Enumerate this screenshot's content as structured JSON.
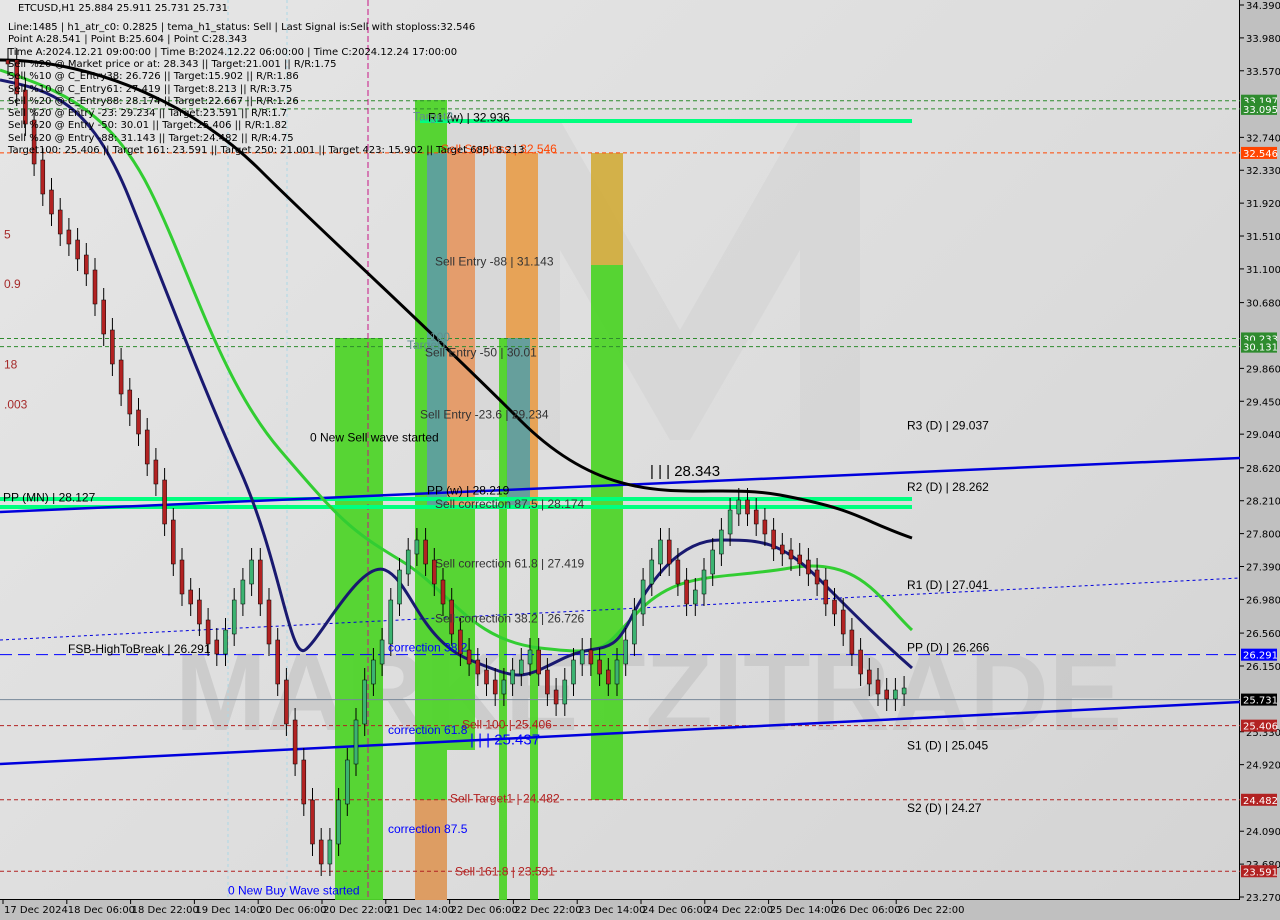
{
  "header": {
    "symbol_line": "ETCUSD,H1  25.884 25.911 25.731 25.731",
    "info_lines": [
      "Line:1485 | h1_atr_c0: 0.2825 | tema_h1_status: Sell | Last Signal is:Sell with stoploss:32.546",
      "Point A:28.541 | Point B:25.604 | Point C:28.343",
      "Time A:2024.12.21 09:00:00 | Time B:2024.12.22 06:00:00 | Time C:2024.12.24 17:00:00",
      "Sell %20 @ Market price or at: 28.343 || Target:21.001 || R/R:1.75",
      "Sell %10 @ C_Entry38: 26.726 || Target:15.902 || R/R:1.86",
      "Sell %10 @ C_Entry61: 27.419 || Target:8.213 || R/R:3.75",
      "Sell %20 @ C_Entry88: 28.174 || Target:22.667 || R/R:1.26",
      "Sell %20 @ Entry -23: 29.234 || Target:23.591 || R/R:1.7",
      "Sell %20 @ Entry -50: 30.01 || Target:25.406 || R/R:1.82",
      "Sell %20 @ Entry -88: 31.143 || Target:24.482 || R/R:4.75",
      "Target100: 25.406 || Target 161: 23.591 || Target 250: 21.001 || Target 423: 15.902 || Target 685: 8.213"
    ]
  },
  "chart_data": {
    "type": "candlestick",
    "title": "ETCUSD,H1",
    "ohlc_last": {
      "open": 25.884,
      "high": 25.911,
      "low": 25.731,
      "close": 25.731
    },
    "ylim": [
      23.27,
      34.39
    ],
    "y_ticks": [
      34.39,
      33.98,
      33.57,
      32.74,
      32.33,
      31.92,
      31.51,
      31.1,
      30.68,
      29.86,
      29.45,
      29.04,
      28.62,
      28.21,
      27.8,
      27.39,
      26.98,
      26.56,
      26.15,
      25.33,
      24.92,
      24.09,
      23.68,
      23.27
    ],
    "x_ticks": [
      "17 Dec 2024",
      "18 Dec 06:00",
      "18 Dec 22:00",
      "19 Dec 14:00",
      "20 Dec 06:00",
      "20 Dec 22:00",
      "21 Dec 14:00",
      "22 Dec 06:00",
      "22 Dec 22:00",
      "23 Dec 14:00",
      "24 Dec 06:00",
      "24 Dec 22:00",
      "25 Dec 14:00",
      "26 Dec 06:00",
      "26 Dec 22:00"
    ],
    "price_badges": [
      {
        "value": "33.197",
        "color": "#2e8b2e"
      },
      {
        "value": "33.095",
        "color": "#2e8b2e"
      },
      {
        "value": "32.546",
        "color": "#ff4500"
      },
      {
        "value": "30.233",
        "color": "#2e8b2e"
      },
      {
        "value": "30.131",
        "color": "#2e8b2e"
      },
      {
        "value": "26.291",
        "color": "#0000ff"
      },
      {
        "value": "25.731",
        "color": "#000000"
      },
      {
        "value": "25.406",
        "color": "#b22222"
      },
      {
        "value": "24.482",
        "color": "#b22222"
      },
      {
        "value": "23.591",
        "color": "#b22222"
      }
    ],
    "level_labels": [
      {
        "text": "R1 (w) | 32.936",
        "price": 32.936,
        "color": "#000000"
      },
      {
        "text": "Target2",
        "price": 32.95,
        "color": "#5f8f8f"
      },
      {
        "text": "Sell Stoploss | 32.546",
        "price": 32.546,
        "color": "#ff4500"
      },
      {
        "text": "Sell Entry -88 | 31.143",
        "price": 31.143,
        "color": "#333333"
      },
      {
        "text": "Target1",
        "price": 30.1,
        "color": "#5f8f8f"
      },
      {
        "text": "100",
        "price": 30.2,
        "color": "#5f8f8f"
      },
      {
        "text": "Sell Entry -50 | 30.01",
        "price": 30.01,
        "color": "#333333"
      },
      {
        "text": "Sell Entry -23.6 | 29.234",
        "price": 29.234,
        "color": "#333333"
      },
      {
        "text": "0 New Sell wave started",
        "price": 28.95,
        "color": "#000000"
      },
      {
        "text": "| | | 28.343",
        "price": 28.52,
        "color": "#000000"
      },
      {
        "text": "PP (w) | 28.219",
        "price": 28.29,
        "color": "#000000"
      },
      {
        "text": "PP (MN) | 28.127",
        "price": 28.2,
        "color": "#000000"
      },
      {
        "text": "Sell correction 87.5 | 28.174",
        "price": 28.12,
        "color": "#333333"
      },
      {
        "text": "Sell correction 61.8 | 27.419",
        "price": 27.38,
        "color": "#333333"
      },
      {
        "text": "Sell correction 38.2 | 26.726",
        "price": 26.69,
        "color": "#333333"
      },
      {
        "text": "correction 38.2",
        "price": 26.33,
        "color": "#0000ff"
      },
      {
        "text": "FSB-HighToBreak | 26.291",
        "price": 26.31,
        "color": "#000000"
      },
      {
        "text": "Sell 100 | 25.406",
        "price": 25.37,
        "color": "#b22222"
      },
      {
        "text": "correction 61.8",
        "price": 25.3,
        "color": "#0000ff"
      },
      {
        "text": "| | | 25.437",
        "price": 25.17,
        "color": "#0000ff"
      },
      {
        "text": "Sell Target1 | 24.482",
        "price": 24.45,
        "color": "#b22222"
      },
      {
        "text": "correction 87.5",
        "price": 24.07,
        "color": "#0000ff"
      },
      {
        "text": "Sell 161.8 | 23.591",
        "price": 23.54,
        "color": "#b22222"
      },
      {
        "text": "0 New Buy Wave started",
        "price": 23.3,
        "color": "#0000ff"
      },
      {
        "text": "R3 (D) | 29.037",
        "price": 29.1,
        "color": "#000000"
      },
      {
        "text": "R2 (D) | 28.262",
        "price": 28.33,
        "color": "#000000"
      },
      {
        "text": "R1 (D) | 27.041",
        "price": 27.11,
        "color": "#000000"
      },
      {
        "text": "PP (D) | 26.266",
        "price": 26.33,
        "color": "#000000"
      },
      {
        "text": "S1 (D) | 25.045",
        "price": 25.11,
        "color": "#000000"
      },
      {
        "text": "S2 (D) | 24.27",
        "price": 24.33,
        "color": "#000000"
      }
    ],
    "left_partial_labels": [
      {
        "text": "5",
        "price": 31.48
      },
      {
        "text": "0.9",
        "price": 30.86
      },
      {
        "text": "18",
        "price": 29.86
      },
      {
        "text": ".003",
        "price": 29.36
      }
    ],
    "watermark": "MARKETZITRADE"
  }
}
